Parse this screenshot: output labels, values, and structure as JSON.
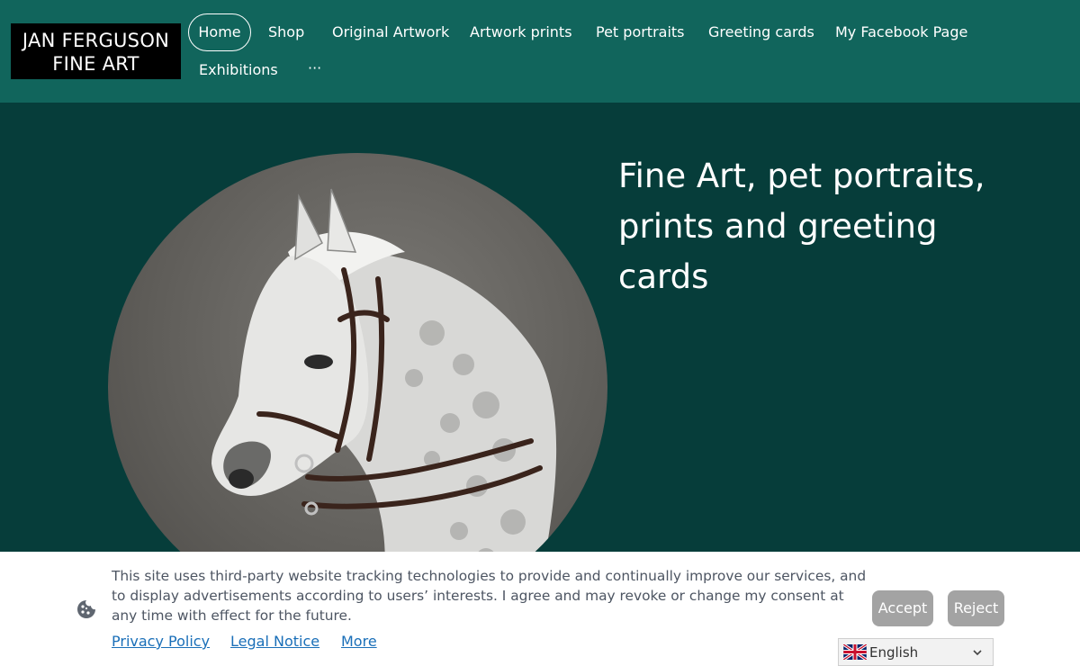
{
  "logo": {
    "line1": "JAN FERGUSON",
    "line2": "FINE ART"
  },
  "nav": {
    "items": [
      {
        "label": "Home"
      },
      {
        "label": "Shop"
      },
      {
        "label": "Original Artwork"
      },
      {
        "label": "Artwork prints"
      },
      {
        "label": "Pet portraits"
      },
      {
        "label": "Greeting cards"
      },
      {
        "label": "My Facebook Page"
      },
      {
        "label": "Exhibitions"
      },
      {
        "label": "···"
      }
    ]
  },
  "hero": {
    "title": "Fine Art, pet portraits, prints and greeting cards",
    "image_icon": "horse-portrait-painting"
  },
  "cookie": {
    "icon": "cookie-icon",
    "text": "This site uses third-party website tracking technologies to provide and continually improve our services, and to display advertisements according to users’ interests. I agree and may revoke or change my consent at any time with effect for the future.",
    "links": {
      "privacy": "Privacy Policy",
      "legal": "Legal Notice",
      "more": "More"
    },
    "accept_label": "Accept",
    "reject_label": "Reject"
  },
  "language": {
    "selected": "English",
    "flag_icon": "uk-flag-icon"
  },
  "colors": {
    "header_bg": "#11655c",
    "hero_bg": "#063d3a",
    "button_bg": "#a3a3a3",
    "link": "#1a6fb8"
  }
}
